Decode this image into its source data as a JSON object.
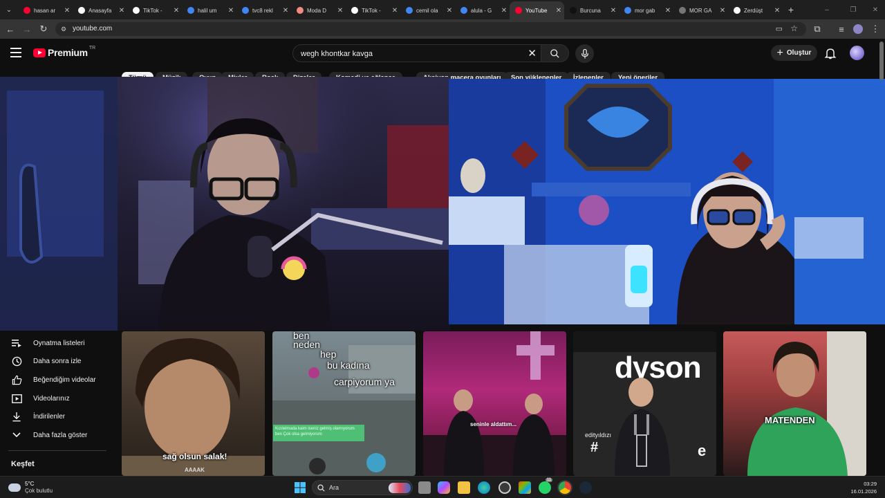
{
  "browser": {
    "tabs": [
      {
        "title": "hasan ar",
        "favicon": "youtube-icon",
        "color": "#ff0033"
      },
      {
        "title": "Anasayfa",
        "favicon": "x-icon",
        "color": "#ffffff"
      },
      {
        "title": "TikTok -",
        "favicon": "tiktok-icon",
        "color": "#ffffff"
      },
      {
        "title": "halil um",
        "favicon": "google-icon",
        "color": "#4285f4"
      },
      {
        "title": "tvc8 rekl",
        "favicon": "google-icon",
        "color": "#4285f4"
      },
      {
        "title": "Moda D",
        "favicon": "moda-icon",
        "color": "#f28b82"
      },
      {
        "title": "TikTok -",
        "favicon": "tiktok-icon",
        "color": "#ffffff"
      },
      {
        "title": "cemil ola",
        "favicon": "google-icon",
        "color": "#4285f4"
      },
      {
        "title": "alula - G",
        "favicon": "google-icon",
        "color": "#4285f4"
      },
      {
        "title": "YouTube",
        "favicon": "youtube-icon",
        "color": "#ff0033",
        "active": true
      },
      {
        "title": "Burcuna",
        "favicon": "burcuna-icon",
        "color": "#111111"
      },
      {
        "title": "mor gab",
        "favicon": "google-icon",
        "color": "#4285f4"
      },
      {
        "title": "MOR GA",
        "favicon": "mor-ga-icon",
        "color": "#777777"
      },
      {
        "title": "Zerdüşt",
        "favicon": "wikipedia-icon",
        "color": "#ffffff"
      }
    ],
    "url": "youtube.com"
  },
  "youtube": {
    "brand": "Premium",
    "country_code": "TR",
    "search_query": "wegh khontkar kavga",
    "create_label": "Oluştur",
    "chips": [
      {
        "label": "Tümü",
        "active": true
      },
      {
        "label": "Müzik"
      },
      {
        "label": "Oyun"
      },
      {
        "label": "Mixler"
      },
      {
        "label": "Rock"
      },
      {
        "label": "Dizeler"
      },
      {
        "label": "Komedi ve eğlence"
      },
      {
        "label": "Aksiyon macera oyunları"
      },
      {
        "label": "Son yüklenenler"
      },
      {
        "label": "İzlenenler"
      },
      {
        "label": "Yeni öneriler"
      }
    ],
    "sidebar": [
      {
        "label": "Oynatma listeleri",
        "icon": "playlist-icon"
      },
      {
        "label": "Daha sonra izle",
        "icon": "clock-icon"
      },
      {
        "label": "Beğendiğim videolar",
        "icon": "thumb-up-icon"
      },
      {
        "label": "Videolarınız",
        "icon": "video-icon"
      },
      {
        "label": "İndirilenler",
        "icon": "download-icon"
      },
      {
        "label": "Daha fazla göster",
        "icon": "chevron-down-icon"
      }
    ],
    "explore_heading": "Keşfet",
    "shorts": [
      {
        "caption": "sağ olsun salak!",
        "watermark": "AAAAK"
      },
      {
        "caption_lines": [
          "ben",
          "neden",
          "hep",
          "bu kadına",
          "carpiyorum ya"
        ],
        "sticker": "Kızılelmada kaim iseniz gelmiş olamıyorum ben Çok olsa gelmiyorum"
      },
      {
        "caption": "seninle aldattım..."
      },
      {
        "caption_brand": "dyson",
        "caption": "edityıldızı",
        "hash": "#",
        "letter": "e"
      },
      {
        "caption": "MATENDEN"
      }
    ]
  },
  "taskbar": {
    "weather_temp": "5°C",
    "weather_desc": "Çok bulutlu",
    "search_label": "Ara",
    "time": "03:29",
    "date": "16.01.2026",
    "notification_badge": "11"
  }
}
